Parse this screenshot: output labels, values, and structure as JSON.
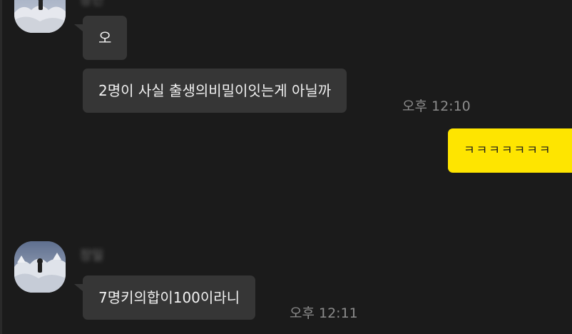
{
  "chat": {
    "messages": [
      {
        "sender_name": "장인",
        "text": "오"
      },
      {
        "text": "2명이 사실 출생의비밀이잇는게 아닐까",
        "time": "오후 12:10"
      },
      {
        "text": "ㅋㅋㅋㅋㅋㅋㅋ",
        "mine": true
      },
      {
        "sender_name": "장일",
        "text": "7명키의합이100이라니",
        "time": "오후 12:11"
      }
    ]
  },
  "colors": {
    "background": "#1b1b1b",
    "bubble_other": "#363636",
    "bubble_mine": "#fee500",
    "time_text": "#8c8c8c"
  },
  "icons": [
    "profile-avatar"
  ]
}
